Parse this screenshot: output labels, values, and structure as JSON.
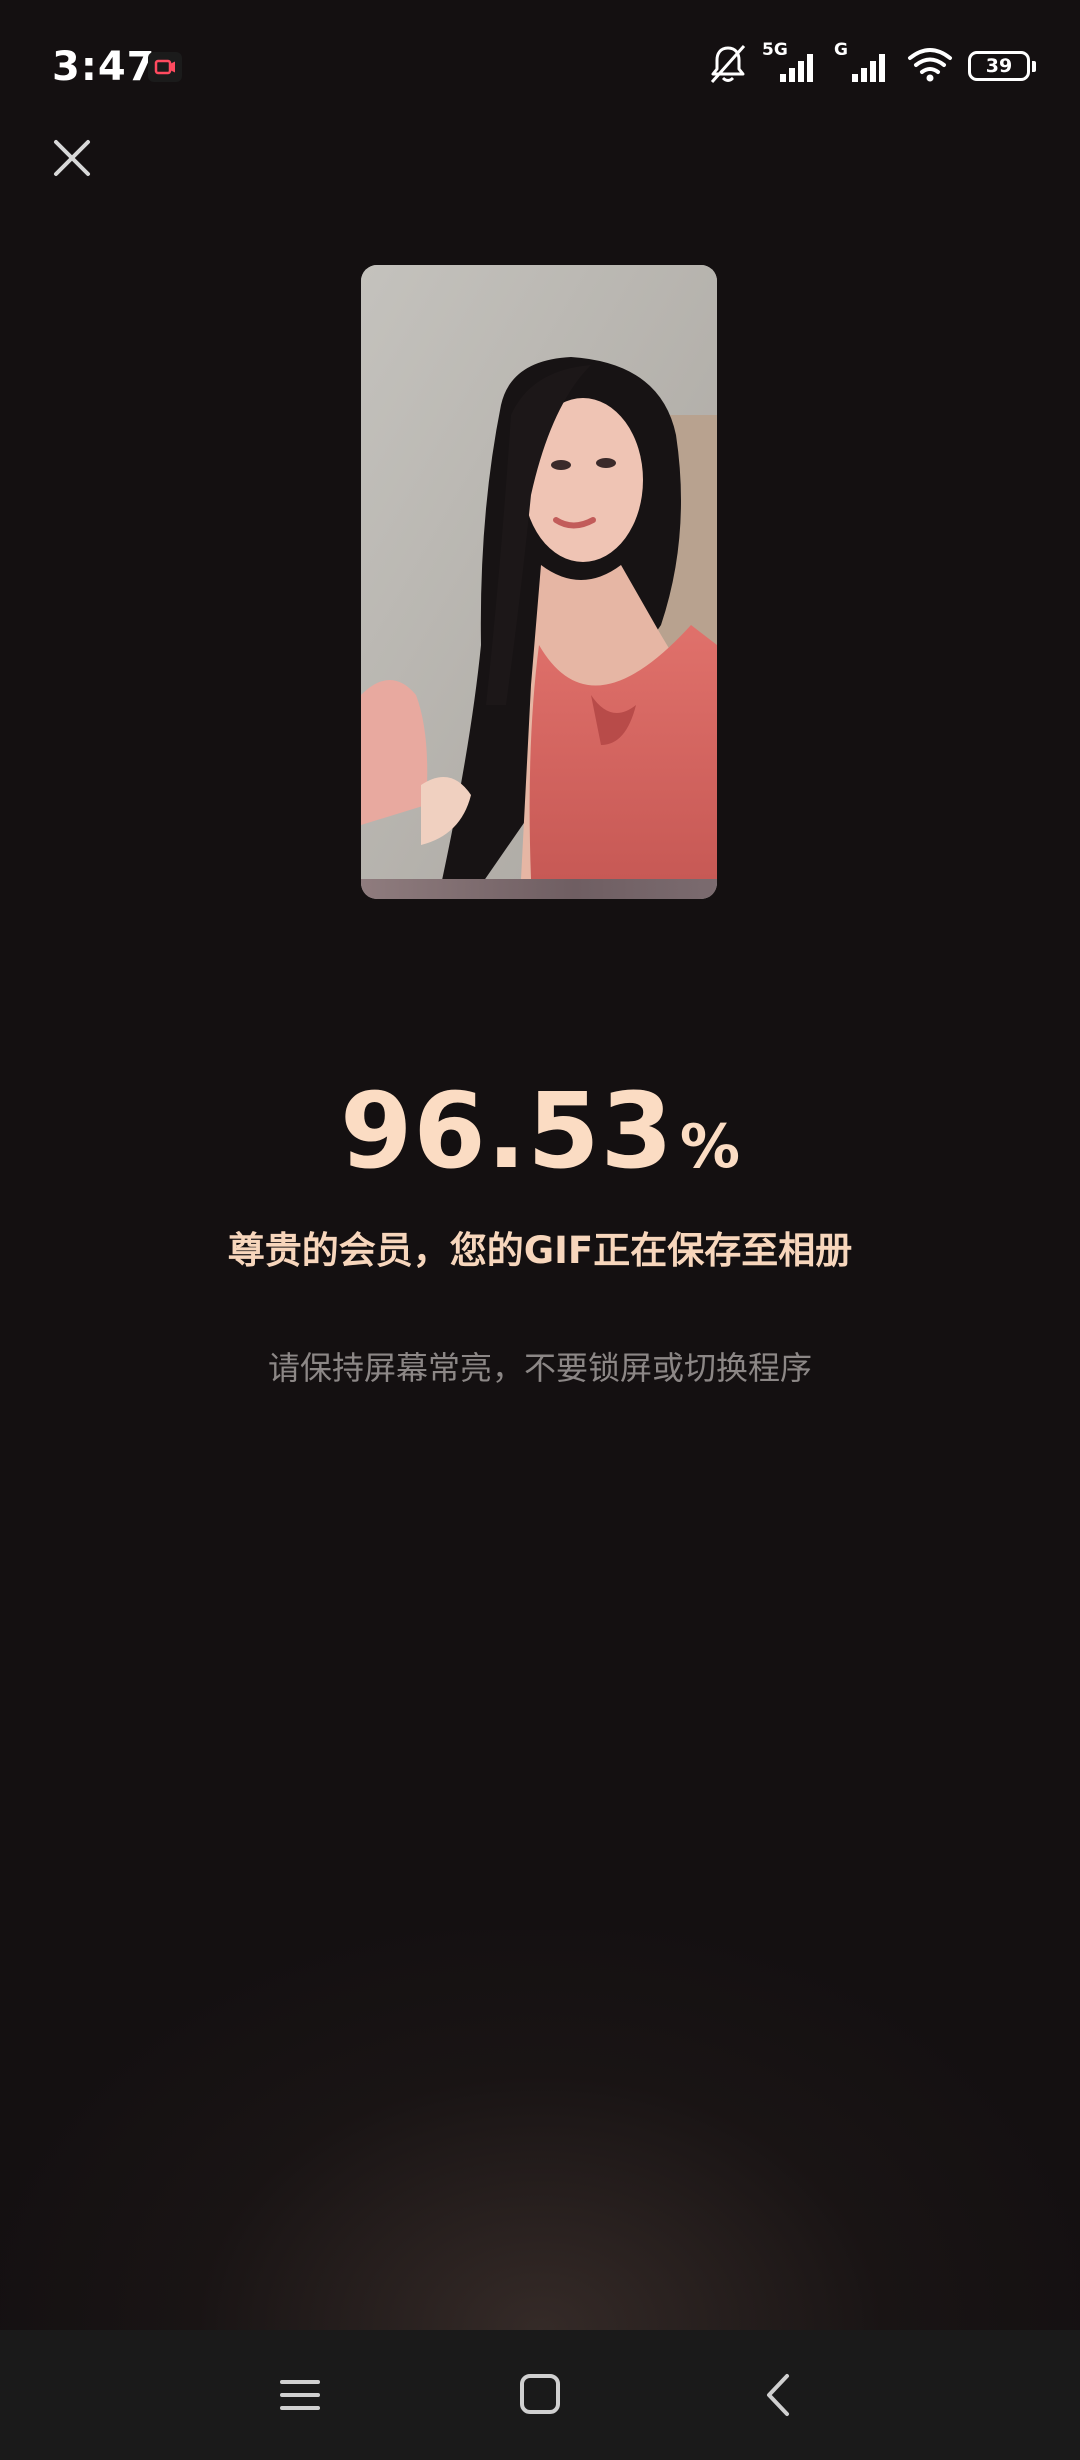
{
  "status_bar": {
    "time": "3:47",
    "network_1": "5G",
    "network_2": "G",
    "battery": "39"
  },
  "progress": {
    "value": "96.53",
    "unit": "%"
  },
  "messages": {
    "saving": "尊贵的会员，您的GIF正在保存至相册",
    "hint": "请保持屏幕常亮，不要锁屏或切换程序"
  },
  "icons": {
    "close": "close-icon",
    "menu": "menu-icon",
    "home": "home-icon",
    "back": "back-icon"
  },
  "colors": {
    "background": "#141011",
    "accent": "#fbdcc3",
    "hint": "#8c8786"
  }
}
